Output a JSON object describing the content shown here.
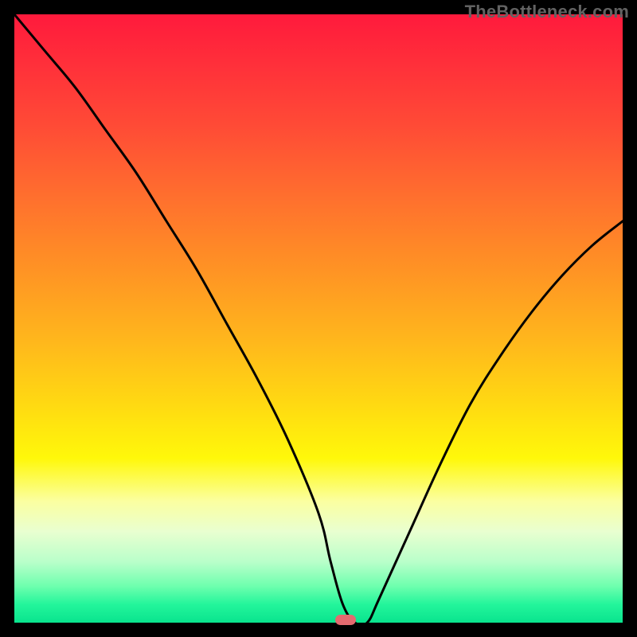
{
  "watermark": "TheBottleneck.com",
  "marker": {
    "x_frac": 0.545,
    "color": "#e46a6f"
  },
  "chart_data": {
    "type": "line",
    "title": "",
    "xlabel": "",
    "ylabel": "",
    "xlim": [
      0,
      100
    ],
    "ylim": [
      0,
      100
    ],
    "series": [
      {
        "name": "bottleneck-curve",
        "x": [
          0,
          5,
          10,
          15,
          20,
          25,
          30,
          35,
          40,
          45,
          50,
          52,
          54,
          56,
          58,
          60,
          65,
          70,
          75,
          80,
          85,
          90,
          95,
          100
        ],
        "y": [
          100,
          94,
          88,
          81,
          74,
          66,
          58,
          49,
          40,
          30,
          18,
          10,
          3,
          0,
          0,
          4,
          15,
          26,
          36,
          44,
          51,
          57,
          62,
          66
        ]
      }
    ],
    "background_gradient": {
      "top": "#ff1a3c",
      "mid": "#ffe400",
      "bottom": "#09e48e"
    }
  }
}
